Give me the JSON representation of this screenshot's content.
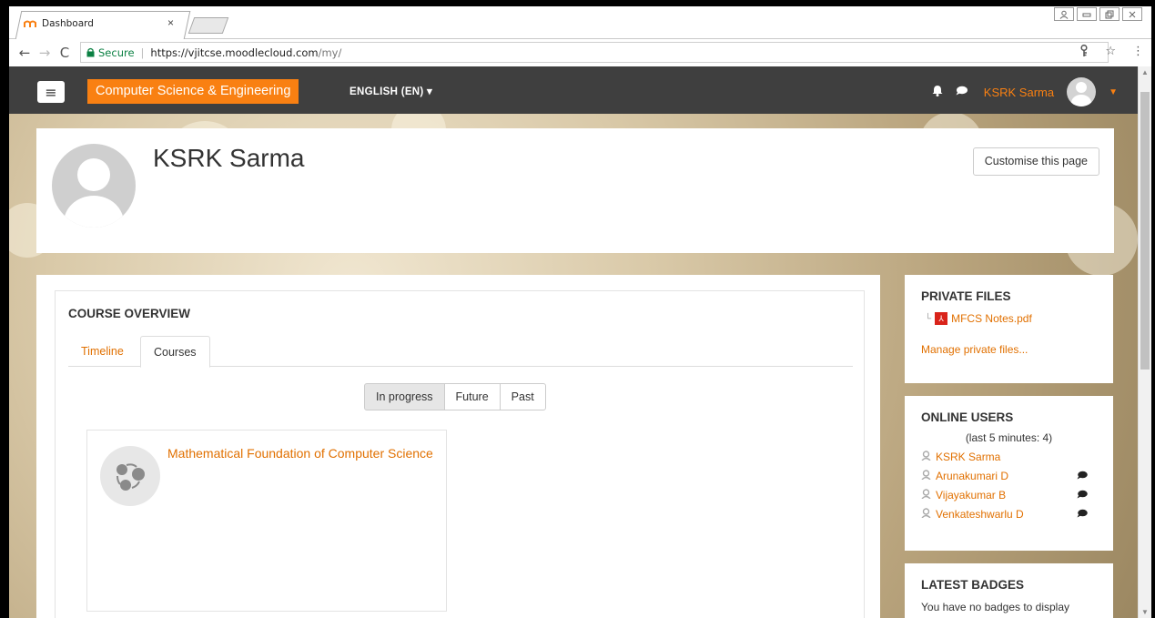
{
  "browser": {
    "tab_title": "Dashboard",
    "tab_close": "×",
    "nav": {
      "back": "←",
      "forward": "→",
      "reload": "C"
    },
    "secure_label": "Secure",
    "url_host": "https://vjitcse.moodlecloud.com",
    "url_path": "/my/",
    "key_icon": "🔑",
    "star_icon": "☆",
    "menu_icon": "⋮",
    "window_buttons": [
      "&",
      "▭",
      "✕"
    ]
  },
  "navbar": {
    "menu_icon": "≡",
    "site_name": "Computer Science & Engineering",
    "language": "ENGLISH (EN) ▾",
    "bell_icon": "🔔",
    "chat_icon": "💬",
    "user_name": "KSRK Sarma",
    "user_caret": "▼",
    "brand_color": "#f98012"
  },
  "header": {
    "title": "KSRK Sarma",
    "customise_button": "Customise this page"
  },
  "course_overview": {
    "title": "COURSE OVERVIEW",
    "tabs": [
      {
        "label": "Timeline",
        "active": false
      },
      {
        "label": "Courses",
        "active": true
      }
    ],
    "filters": [
      {
        "label": "In progress",
        "active": true
      },
      {
        "label": "Future",
        "active": false
      },
      {
        "label": "Past",
        "active": false
      }
    ],
    "courses": [
      {
        "name": "Mathematical Foundation of Computer Science"
      }
    ]
  },
  "private_files": {
    "title": "PRIVATE FILES",
    "files": [
      {
        "name": "MFCS Notes.pdf",
        "icon": "pdf-icon"
      }
    ],
    "manage_link": "Manage private files..."
  },
  "online_users": {
    "title": "ONLINE USERS",
    "subtitle": "(last 5 minutes: 4)",
    "users": [
      {
        "name": "KSRK Sarma",
        "message_icon": false
      },
      {
        "name": "Arunakumari D",
        "message_icon": true
      },
      {
        "name": "Vijayakumar B",
        "message_icon": true
      },
      {
        "name": "Venkateshwarlu D",
        "message_icon": true
      }
    ]
  },
  "latest_badges": {
    "title": "LATEST BADGES",
    "text": "You have no badges to display"
  }
}
